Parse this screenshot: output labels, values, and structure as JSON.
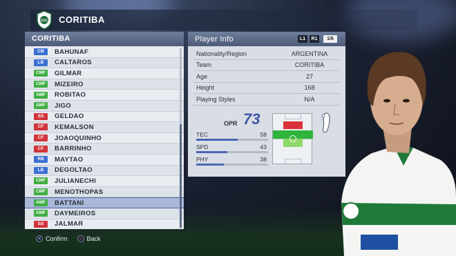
{
  "header": {
    "team_name": "CORITIBA"
  },
  "list": {
    "title": "CORITIBA",
    "players": [
      {
        "pos": "CB",
        "name": "BAHUNAF",
        "color": "#3c6fd1"
      },
      {
        "pos": "LB",
        "name": "CALTAROS",
        "color": "#3c6fd1"
      },
      {
        "pos": "CMF",
        "name": "GILMAR",
        "color": "#3fae43"
      },
      {
        "pos": "CMF",
        "name": "MIZEIRO",
        "color": "#3fae43"
      },
      {
        "pos": "AMF",
        "name": "ROBITAO",
        "color": "#3fae43"
      },
      {
        "pos": "AMF",
        "name": "JIGO",
        "color": "#3fae43"
      },
      {
        "pos": "SS",
        "name": "GELDAO",
        "color": "#d0343a"
      },
      {
        "pos": "CF",
        "name": "KEMALSON",
        "color": "#d0343a"
      },
      {
        "pos": "CF",
        "name": "JOAOQUINHO",
        "color": "#d0343a"
      },
      {
        "pos": "CF",
        "name": "BARRINHO",
        "color": "#d0343a"
      },
      {
        "pos": "RB",
        "name": "MAYTAO",
        "color": "#3c6fd1"
      },
      {
        "pos": "LB",
        "name": "DEGOLTAO",
        "color": "#3c6fd1"
      },
      {
        "pos": "CMF",
        "name": "JULIANECHI",
        "color": "#3fae43"
      },
      {
        "pos": "CMF",
        "name": "MENOTHOPAS",
        "color": "#3fae43"
      },
      {
        "pos": "AMF",
        "name": "BATTANI",
        "color": "#3fae43"
      },
      {
        "pos": "AMF",
        "name": "DAYMEIROS",
        "color": "#3fae43"
      },
      {
        "pos": "SS",
        "name": "JALMAR",
        "color": "#d0343a"
      }
    ],
    "selected_index": 14
  },
  "info": {
    "title": "Player Info",
    "tag_l1": "L1",
    "tag_r1": "R1",
    "page": "1/6",
    "rows": [
      {
        "label": "Nationality/Region",
        "value": "ARGENTINA"
      },
      {
        "label": "Team",
        "value": "CORITIBA"
      },
      {
        "label": "Age",
        "value": "27"
      },
      {
        "label": "Height",
        "value": "168"
      },
      {
        "label": "Playing Styles",
        "value": "N/A"
      }
    ],
    "opr_label": "OPR",
    "opr_value": "73",
    "stats": [
      {
        "label": "TEC",
        "value": "58",
        "level": 0.58
      },
      {
        "label": "SPD",
        "value": "43",
        "level": 0.43
      },
      {
        "label": "PHY",
        "value": "38",
        "level": 0.38
      }
    ]
  },
  "footer": {
    "confirm_label": "Confirm",
    "back_label": "Back"
  },
  "colors": {
    "accent": "#3f58a4",
    "forward_zone": "#d9323a",
    "midfield_zone": "#2fb53b"
  }
}
